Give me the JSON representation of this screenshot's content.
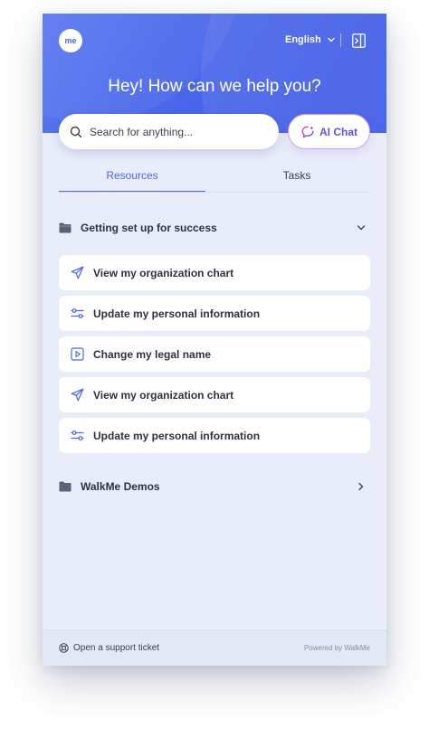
{
  "header": {
    "logo_text": "me",
    "language": "English",
    "greeting": "Hey! How can we help you?"
  },
  "search": {
    "placeholder": "Search for anything..."
  },
  "ai_chat": {
    "label": "AI Chat"
  },
  "tabs": [
    {
      "label": "Resources",
      "active": true
    },
    {
      "label": "Tasks",
      "active": false
    }
  ],
  "sections": [
    {
      "title": "Getting set up for success",
      "expanded": true,
      "items": [
        {
          "label": "View my organization chart",
          "icon": "send-icon"
        },
        {
          "label": "Update my personal information",
          "icon": "sliders-icon"
        },
        {
          "label": "Change my legal name",
          "icon": "play-icon"
        },
        {
          "label": "View my organization chart",
          "icon": "send-icon"
        },
        {
          "label": "Update my personal information",
          "icon": "sliders-icon"
        }
      ]
    },
    {
      "title": "WalkMe Demos",
      "expanded": false,
      "items": []
    }
  ],
  "footer": {
    "support_label": "Open a support ticket",
    "powered_by": "Powered by WalkMe"
  },
  "colors": {
    "accent": "#4a67ea",
    "panel_bg": "#e9edf9",
    "ai_accent": "#6a4fd6"
  }
}
